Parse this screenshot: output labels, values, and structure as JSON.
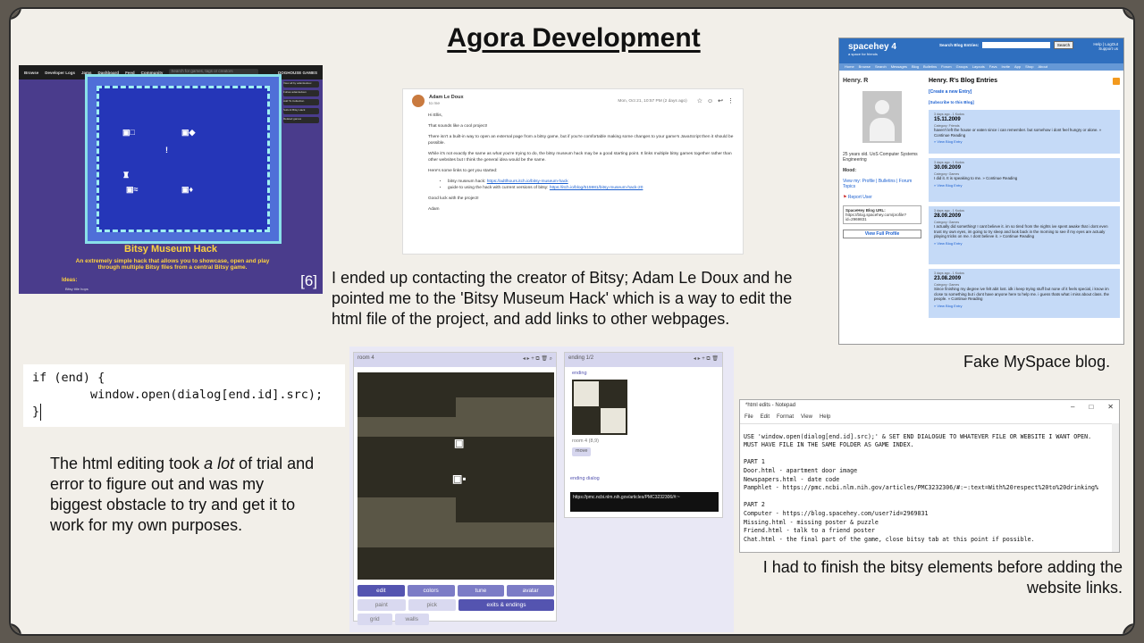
{
  "title": "Agora Development",
  "captions": {
    "contact": "I ended up contacting the creator of Bitsy; Adam Le Doux and he pointed me to the 'Bitsy Museum Hack' which is a way to edit the html file of the project, and add links to other webpages.",
    "myspace": "Fake MySpace blog.",
    "html_prefix": "The html editing took ",
    "html_emph": "a lot",
    "html_suffix": " of trial and error to figure out and was my biggest obstacle to try and get it to work for my own purposes.",
    "bitsy": "I had to finish the bitsy elements before adding the website links."
  },
  "itch": {
    "nav": [
      "Browse",
      "Developer Logs",
      "Jams",
      "Dashboard",
      "Feed",
      "Community"
    ],
    "search_placeholder": "Search for games, tags or creators",
    "user": "DOGHOUSE GAMES",
    "sidebar": [
      "View all by adamledoux",
      "Follow adamledoux",
      "Add To Collection",
      "Submit Bitsy Hack",
      "Related games"
    ],
    "game_title": "Bitsy Museum Hack",
    "game_desc": "An extremely simple hack that allows you to showcase, open and play through multiple Bitsy files from a central Bitsy game.",
    "ideas_label": "Ideas:",
    "ideas_item": "Bitsy title hops",
    "ref": "[6]"
  },
  "email": {
    "sender": "Adam Le Doux",
    "to": "to me",
    "date": "Mon, Oct 21, 10:57 PM (2 days ago)",
    "greeting": "Hi Ellis,",
    "p1": "That sounds like a cool project!",
    "p2": "There isn't a built-in way to open an external page from a bitsy game, but if you're comfortable making some changes to your game's JavaScript then it should be possible.",
    "p3": "While it's not exactly the same as what you're trying to do, the bitsy museum hack may be a good starting point. It links multiple bitsy games together rather than other websites but I think the general idea would be the same.",
    "p4": "Here's some links to get you started:",
    "link1_label": "bitsy museum hack: ",
    "link1_url": "https://adtlhours.itch.io/bitsy-museum-hack",
    "link2_label": "guide to using the hack with current versions of bitsy: ",
    "link2_url": "https://itch.io/blog/515981/bitsy-museum-hack-20",
    "closing": "Good luck with the project!",
    "signoff": "Adam"
  },
  "myspace": {
    "logo": "spacehey",
    "number": "4",
    "tagline": "a space for friends",
    "search_label": "Search Blog Entries:",
    "search_button": "Search",
    "top_links": "Help | LogOut",
    "support": "Support us",
    "nav": [
      "Home",
      "Browse",
      "Search",
      "Messages",
      "Blog",
      "Bulletins",
      "Forum",
      "Groups",
      "Layouts",
      "Favs",
      "Invite",
      "App",
      "Shop",
      "About"
    ],
    "profile_name": "Henry. R",
    "bio": "25 years old. UoS Computer Systems Engineering",
    "mood": "Mood:",
    "view_my": "View my: Profile | Bulletins | Forum Topics",
    "report": "Report User",
    "url_label": "SpaceHey Blog URL:",
    "url_value": "https://blog.spacehey.com/profile?id=2969831",
    "view_full": "View Full Profile",
    "blog_title": "Henry. R's Blog Entries",
    "create": "[Create a new Entry]",
    "subscribe": "[Subscribe to this Blog]",
    "entries": [
      {
        "meta": "3 days ago - 1 Kudos",
        "date": "15.11.2009",
        "cat": "Category: Friends",
        "body": "haven't left the house or eaten since i can remember. but somehow i dont feel hungry or alone. » Continue Reading",
        "view": "» View Blog Entry"
      },
      {
        "meta": "3 days ago - 1 Kudos",
        "date": "30.09.2009",
        "cat": "Category: Games",
        "body": "I did it. It is speaking to me. » Continue Reading",
        "view": "» View Blog Entry"
      },
      {
        "meta": "3 days ago - 1 Kudos",
        "date": "28.09.2009",
        "cat": "Category: Games",
        "body": "I actually did something! I cant believe it. im so tired from the nights ive spent awake that i dont even trust my own eyes, im going to try sleep and look back in the morning to see if my eyes are actualy playing tricks on me. I dont believe it. » Continue Reading",
        "view": "» View Blog Entry"
      },
      {
        "meta": "3 days ago - 1 Kudos",
        "date": "23.08.2009",
        "cat": "Category: Games",
        "body": "Since finishing my degree ive felt abit lost. idk i keep trying stuff but none of it feels special, i know im close to something but i dont have anyone here to help me. i guess thats what i miss about class. the people. » Continue Reading",
        "view": "» View Blog Entry"
      }
    ]
  },
  "code": {
    "line1": "if (end) {",
    "line2": "        window.open(dialog[end.id].src);",
    "line3": "}"
  },
  "bitsy": {
    "room_label": "room 4",
    "ending_header": "ending 1/2",
    "ending_label": "ending",
    "room_ref": "room 4 (8,9)",
    "move": "move",
    "dialog_label": "ending dialog",
    "dialog_value": "https://pmc.ncbi.nlm.nih.gov/articles/PMC3232306/#:~",
    "tabs": [
      "edit",
      "colors",
      "tune",
      "avatar"
    ],
    "tools": [
      "paint",
      "pick",
      "exits & endings"
    ],
    "toggles": [
      "grid",
      "walls"
    ]
  },
  "notepad": {
    "title": "*html edits - Notepad",
    "menu": [
      "File",
      "Edit",
      "Format",
      "View",
      "Help"
    ],
    "lines": [
      "USE 'window.open(dialog[end.id].src);' & SET END DIALOGUE TO WHATEVER FILE OR WEBSITE I WANT OPEN.",
      "MUST HAVE FILE IN THE SAME FOLDER AS GAME INDEX.",
      "",
      "PART 1",
      "Door.html - apartment door image",
      "Newspapers.html - date code",
      "Pamphlet - https://pmc.ncbi.nlm.nih.gov/articles/PMC3232306/#:~:text=With%20respect%20to%20drinking%",
      "",
      "PART 2",
      "Computer - https://blog.spacehey.com/user?id=2969831",
      "Missing.html - missing poster & puzzle",
      "Friend.html - talk to a friend poster",
      "Chat.html - the final part of the game, close bitsy tab at this point if possible."
    ]
  }
}
